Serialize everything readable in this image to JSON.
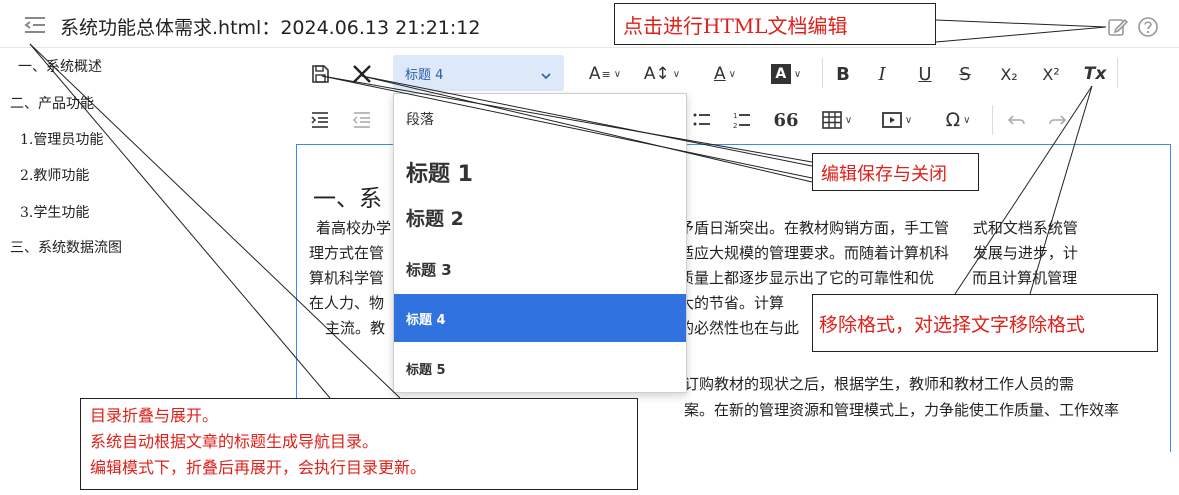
{
  "header": {
    "doc_title": "系统功能总体需求.html：2024.06.13 21:21:12",
    "toc_toggle_icon": "collapse-list-icon",
    "edit_icon": "edit-pencil-icon",
    "help_icon": "help-circle-icon"
  },
  "toc": {
    "items": [
      {
        "label": "一、系统概述"
      },
      {
        "label": "二、产品功能"
      },
      {
        "label": "1.管理员功能"
      },
      {
        "label": "2.教师功能"
      },
      {
        "label": "3.学生功能"
      },
      {
        "label": "三、系统数据流图"
      }
    ]
  },
  "toolbar": {
    "heading_select_value": "标题 4",
    "row1_icons": [
      "save-icon",
      "close-icon",
      "font-size-icon",
      "line-height-icon",
      "font-color-icon",
      "background-color-icon",
      "bold-icon",
      "italic-icon",
      "underline-icon",
      "strikethrough-icon",
      "subscript-icon",
      "superscript-icon",
      "clear-format-icon"
    ],
    "row2_icons": [
      "indent-icon",
      "outdent-icon",
      "bullet-list-icon",
      "numbered-list-icon",
      "blockquote-icon",
      "table-icon",
      "media-icon",
      "special-char-icon",
      "undo-icon",
      "redo-icon"
    ],
    "bold": "B",
    "italic": "I",
    "underline": "U",
    "strike": "S",
    "subscript": "X₂",
    "superscript": "X²",
    "clear_format": "Tx",
    "special_char": "Ω",
    "quote": "66"
  },
  "heading_dropdown": {
    "options": [
      {
        "label": "段落",
        "selected": false
      },
      {
        "label": "标题 1",
        "selected": false
      },
      {
        "label": "标题 2",
        "selected": false
      },
      {
        "label": "标题 3",
        "selected": false
      },
      {
        "label": "标题 4",
        "selected": true
      },
      {
        "label": "标题 5",
        "selected": false
      }
    ]
  },
  "editor": {
    "heading_visible": "一、系",
    "lines": [
      {
        "left": "着高校办学",
        "right": "矛盾日渐突出。在教材购销方面，手工管     式和文档系统管"
      },
      {
        "left": "理方式在管",
        "right": "适应大规模的管理要求。而随着计算机科     发展与进步，计"
      },
      {
        "left": "算机科学管",
        "right": "质量上都逐步显示出了它的可靠性和优        而且计算机管理"
      },
      {
        "left": "在人力、物",
        "right": "大的节省。计算"
      },
      {
        "left": "主流。教",
        "right": "的必然性也在与此"
      },
      {
        "left": "",
        "right": "订购教材的现状之后，根据学生，教师和教材工作人员的需"
      },
      {
        "left": "",
        "right": "案。在新的管理资源和管理模式上，力争能使工作质量、工作效率"
      }
    ]
  },
  "annotations": {
    "html_edit": "点击进行HTML文档编辑",
    "save_close": "编辑保存与关闭",
    "clear_format": "移除格式，对选择文字移除格式",
    "toc_lines": [
      "目录折叠与展开。",
      "系统自动根据文章的标题生成导航目录。",
      "编辑模式下，折叠后再展开，会执行目录更新。"
    ]
  },
  "colors": {
    "annotation_text": "#e0201a",
    "selected_option_bg": "#2f72e0",
    "heading_select_bg": "#dde9f8",
    "editor_border": "#3d8be8"
  }
}
